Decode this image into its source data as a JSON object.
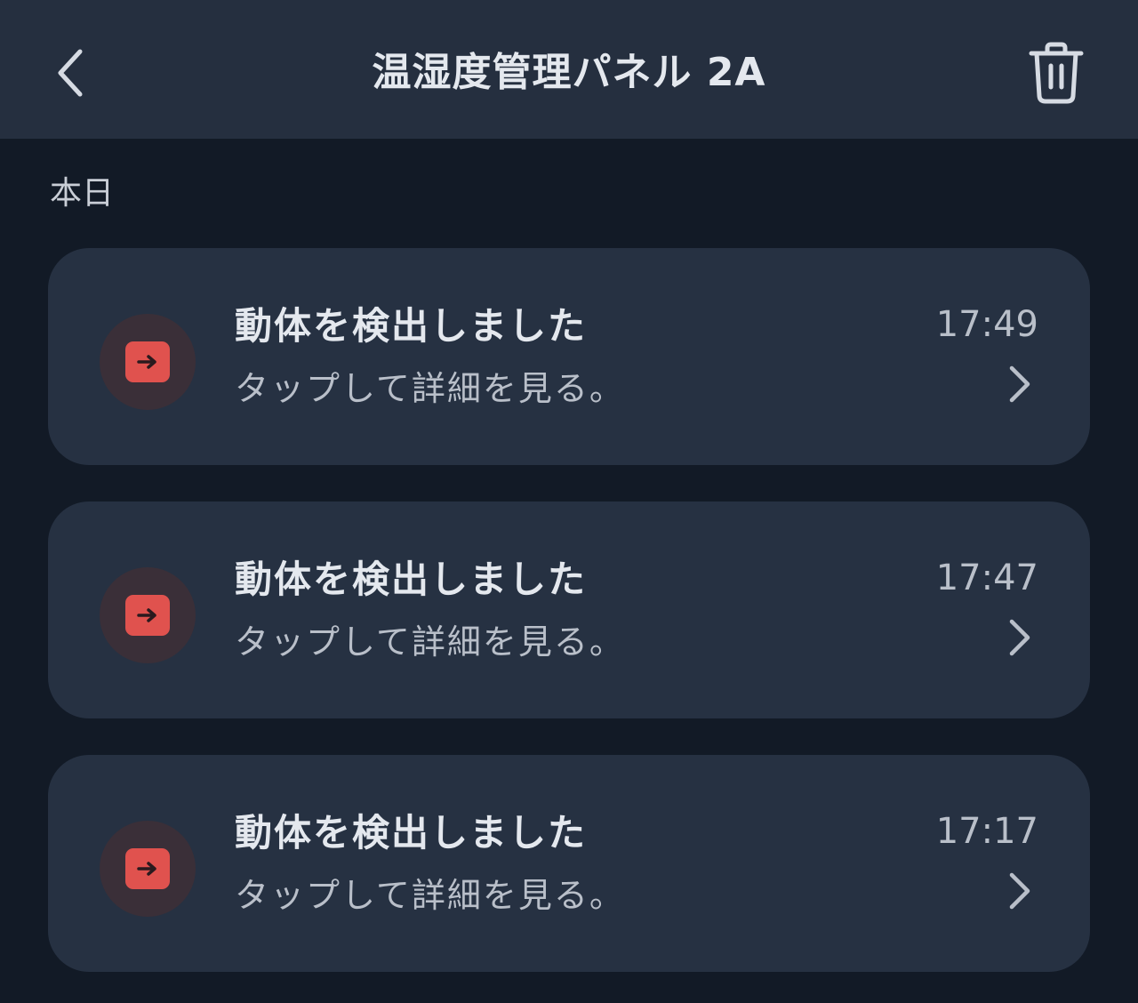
{
  "header": {
    "title": "温湿度管理パネル 2A",
    "back_icon": "chevron-left-icon",
    "delete_icon": "trash-icon"
  },
  "section": {
    "label": "本日"
  },
  "notifications": [
    {
      "title": "動体を検出しました",
      "subtitle": "タップして詳細を見る。",
      "time": "17:49",
      "icon": "arrow-right-square-icon"
    },
    {
      "title": "動体を検出しました",
      "subtitle": "タップして詳細を見る。",
      "time": "17:47",
      "icon": "arrow-right-square-icon"
    },
    {
      "title": "動体を検出しました",
      "subtitle": "タップして詳細を見る。",
      "time": "17:17",
      "icon": "arrow-right-square-icon"
    }
  ],
  "colors": {
    "background": "#121a26",
    "header": "#252f3f",
    "card": "#263142",
    "accent": "#e0524e",
    "icon_ring": "#3a2f38"
  }
}
